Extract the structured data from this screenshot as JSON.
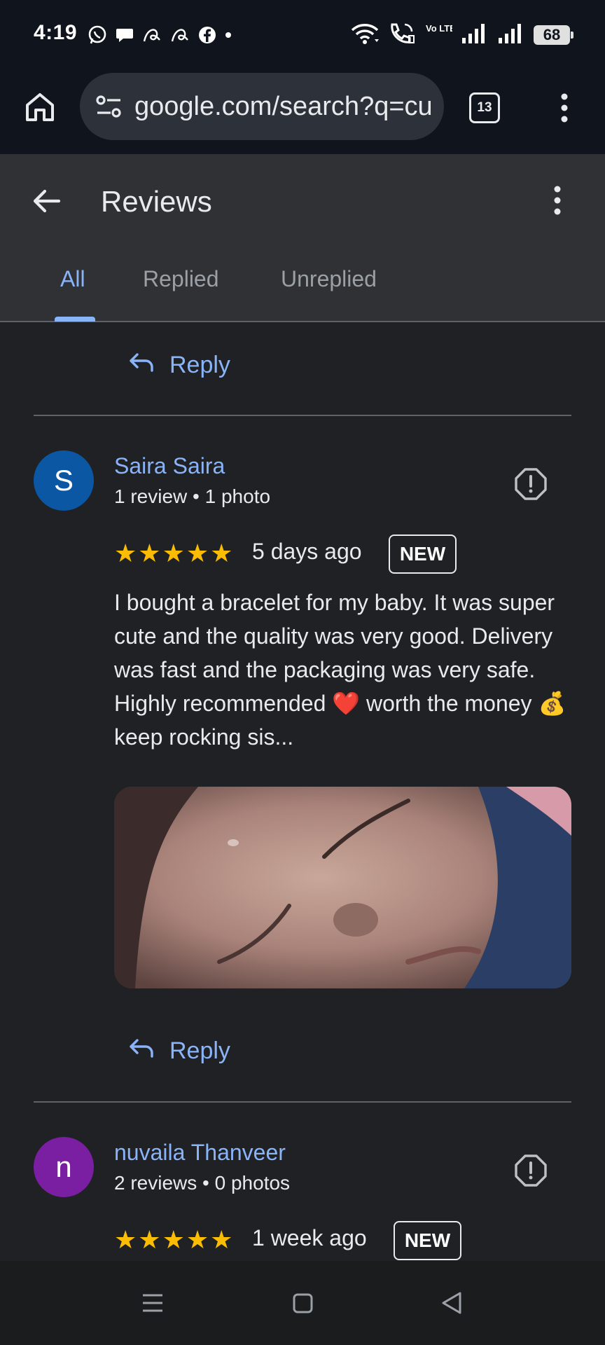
{
  "status_bar": {
    "time": "4:19",
    "battery": "68",
    "left_icons": [
      "whatsapp-icon",
      "chat-bubble-icon",
      "script-a-icon",
      "script-a-icon",
      "facebook-icon",
      "dot-icon"
    ],
    "right_icons": [
      "wifi-icon",
      "wifi-calling-icon",
      "volte-icon",
      "signal-icon",
      "signal-icon",
      "battery-icon"
    ],
    "volte_label": "Vo LTE2"
  },
  "browser": {
    "url": "google.com/search?q=cu",
    "tab_count": "13"
  },
  "header": {
    "title": "Reviews",
    "tabs": [
      {
        "label": "All",
        "active": true
      },
      {
        "label": "Replied",
        "active": false
      },
      {
        "label": "Unreplied",
        "active": false
      }
    ]
  },
  "reply_label": "Reply",
  "reviews": [
    {
      "initial": "S",
      "avatar_color": "#0b57a4",
      "name": "Saira Saira",
      "meta": "1 review • 1 photo",
      "rating": 5,
      "date": "5 days ago",
      "badge": "NEW",
      "text": "I bought a bracelet for my baby. It was super cute and the quality was very good. Delivery was fast and the packaging was very safe. Highly recommended ❤️ worth the money 💰 keep rocking sis...",
      "has_photo": true
    },
    {
      "initial": "n",
      "avatar_color": "#7b1fa2",
      "name": "nuvaila Thanveer",
      "meta": "2 reviews • 0 photos",
      "rating": 5,
      "date": "1 week ago",
      "badge": "NEW"
    }
  ],
  "colors": {
    "accent": "#8ab4f8",
    "star": "#fbbc04",
    "background": "#202124",
    "header": "#303134",
    "status_bar": "#0f141d"
  }
}
